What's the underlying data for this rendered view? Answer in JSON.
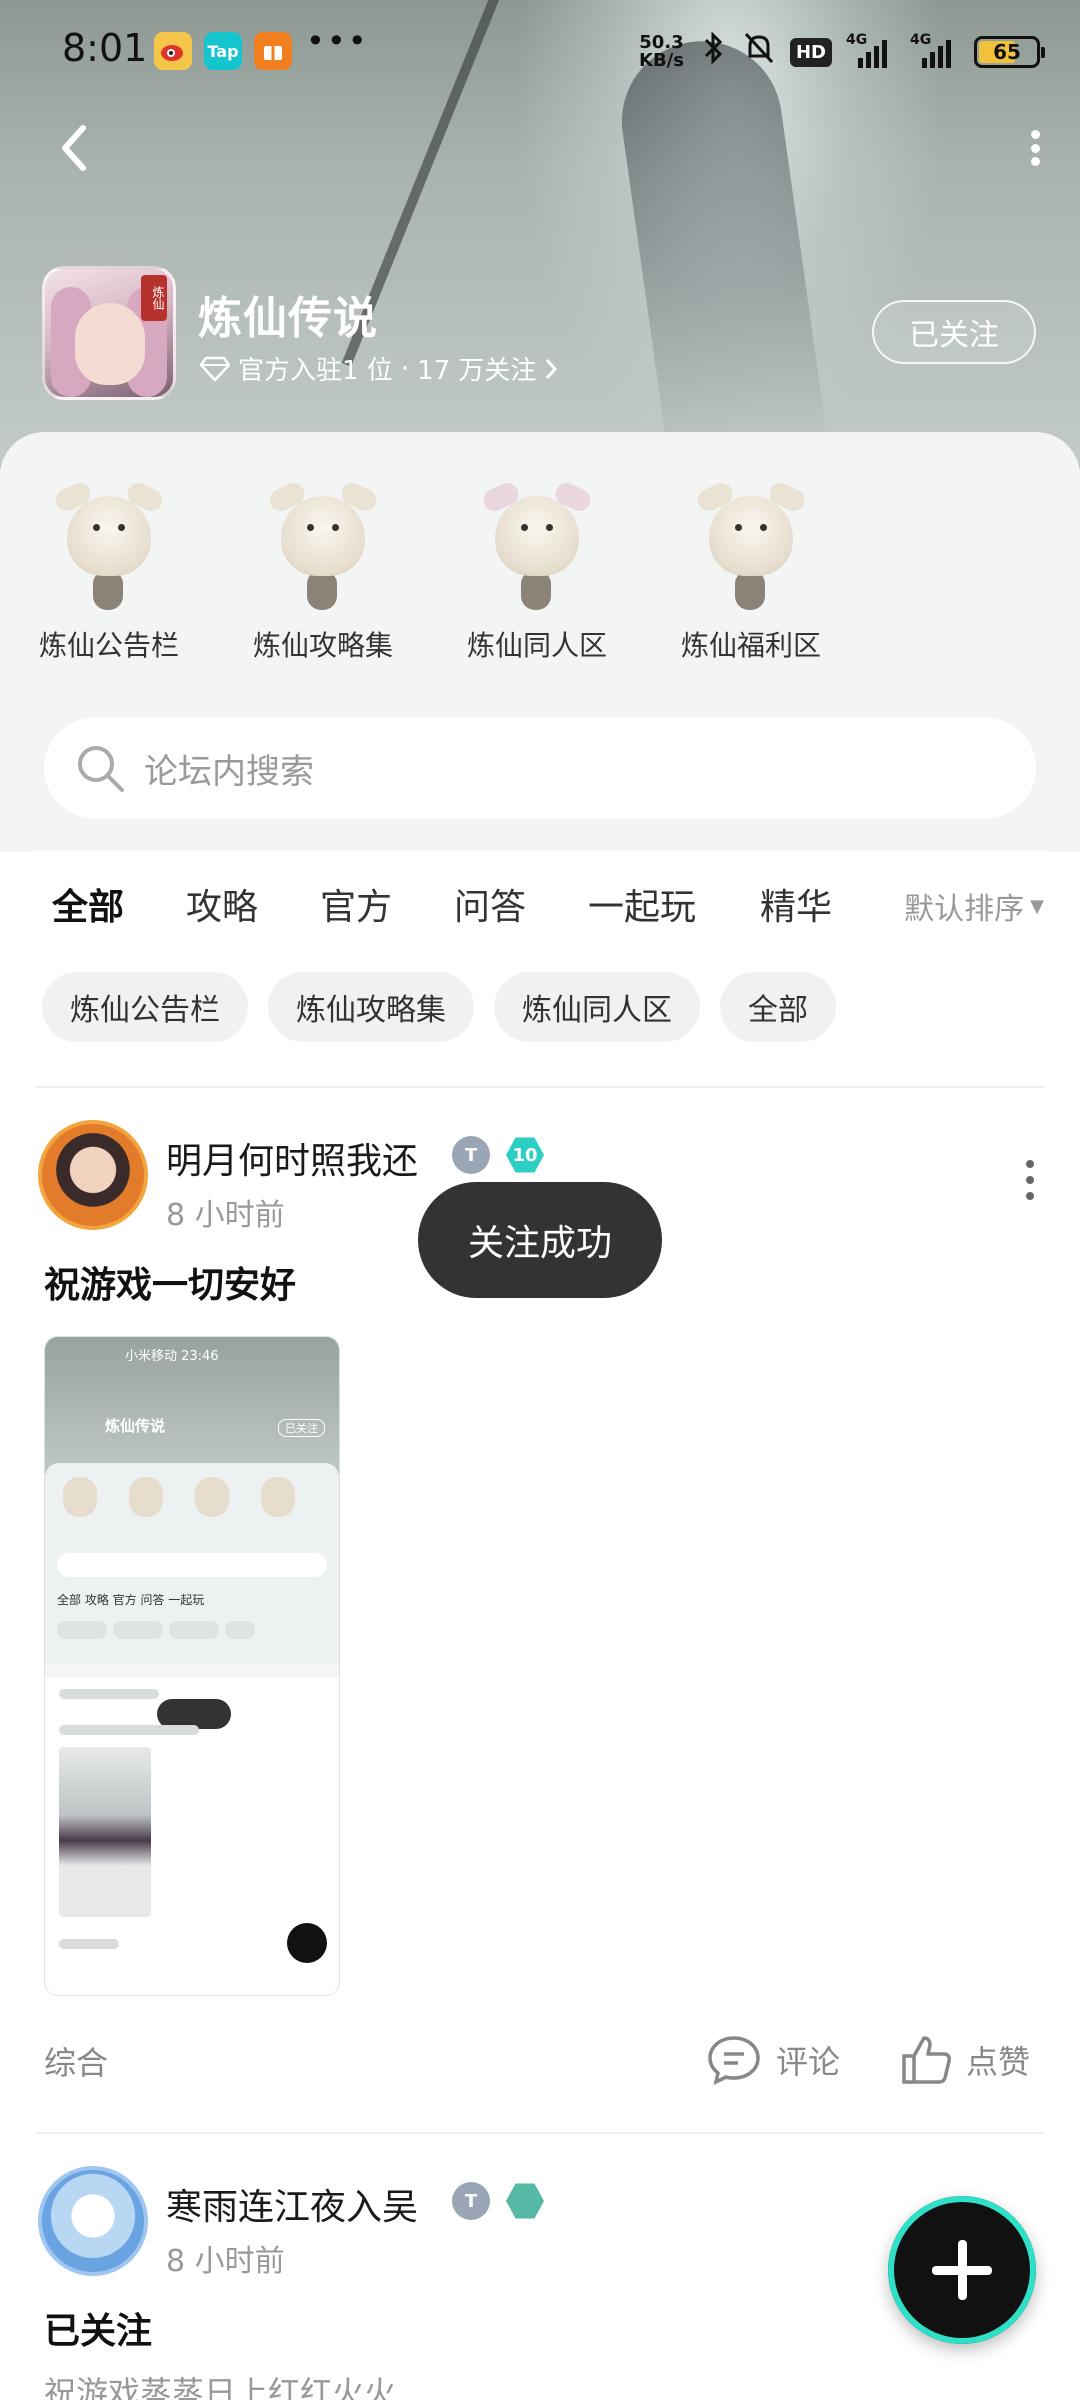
{
  "status_bar": {
    "time": "8:01",
    "apps": [
      "weibo-icon",
      "taptap-icon",
      "gift-app-icon"
    ],
    "app_labels": {
      "taptap": "Tap"
    },
    "more": "•••",
    "net_speed_value": "50.3",
    "net_speed_unit": "KB/s",
    "hd": "HD",
    "signal1": "4G",
    "signal2": "4G",
    "battery": "65",
    "battery_level": 0.65
  },
  "header": {
    "game_title": "炼仙传说",
    "official_text": "官方入驻1 位",
    "separator": "·",
    "followers_text": "17 万关注",
    "follow_button": "已关注",
    "icon_badge": "炼仙"
  },
  "sections": [
    {
      "label": "炼仙公告栏",
      "icon": "mascot-bulletin-icon"
    },
    {
      "label": "炼仙攻略集",
      "icon": "mascot-guide-icon"
    },
    {
      "label": "炼仙同人区",
      "icon": "mascot-fanart-icon"
    },
    {
      "label": "炼仙福利区",
      "icon": "mascot-welfare-icon"
    }
  ],
  "search": {
    "placeholder": "论坛内搜索"
  },
  "tabs": [
    "全部",
    "攻略",
    "官方",
    "问答",
    "一起玩",
    "精华"
  ],
  "sort": {
    "label": "默认排序"
  },
  "chips": [
    "炼仙公告栏",
    "炼仙攻略集",
    "炼仙同人区",
    "全部"
  ],
  "post1": {
    "author": "明月何时照我还",
    "level_badge": "10",
    "time": "8 小时前",
    "title": "祝游戏一切安好",
    "thumb": {
      "status": "小米移动 23:46",
      "tabs": "全部   攻略   官方   问答   一起玩",
      "title": "炼仙传说",
      "follow": "已关注"
    },
    "tag": "综合",
    "comment": "评论",
    "like": "点赞"
  },
  "toast": "关注成功",
  "post2": {
    "author": "寒雨连江夜入吴",
    "time": "8 小时前",
    "title": "已关注",
    "subtitle": "祝游戏蒸蒸日上红红火火"
  },
  "colors": {
    "accent": "#2ccfc3",
    "toast_bg": "#333333",
    "muted_text": "#999999"
  }
}
